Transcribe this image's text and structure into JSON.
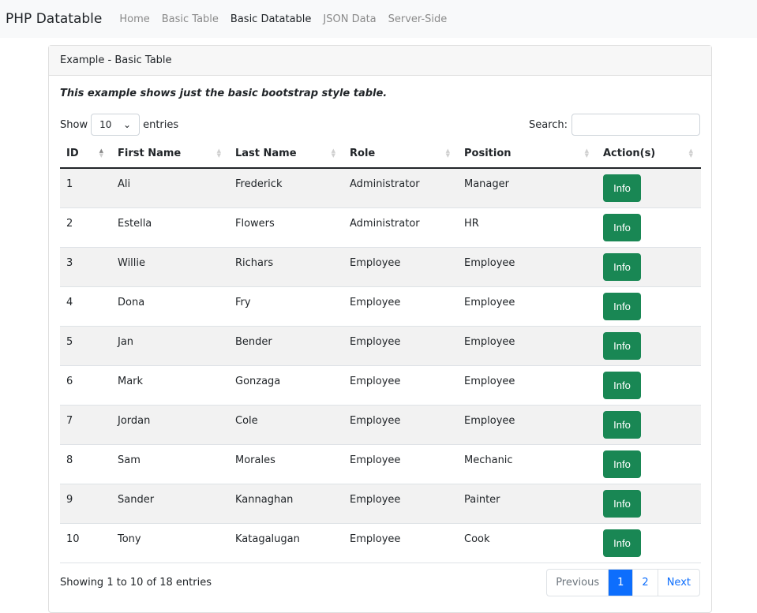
{
  "nav": {
    "brand": "PHP Datatable",
    "links": [
      "Home",
      "Basic Table",
      "Basic Datatable",
      "JSON Data",
      "Server-Side"
    ],
    "active": "Basic Datatable"
  },
  "card": {
    "title": "Example - Basic Table",
    "description": "This example shows just the basic bootstrap style table."
  },
  "controls": {
    "show_label": "Show",
    "length_value": "10",
    "entries_label": "entries",
    "search_label": "Search:",
    "search_value": ""
  },
  "table": {
    "columns": [
      "ID",
      "First Name",
      "Last Name",
      "Role",
      "Position",
      "Action(s)"
    ],
    "rows": [
      [
        "1",
        "Ali",
        "Frederick",
        "Administrator",
        "Manager"
      ],
      [
        "2",
        "Estella",
        "Flowers",
        "Administrator",
        "HR"
      ],
      [
        "3",
        "Willie",
        "Richars",
        "Employee",
        "Employee"
      ],
      [
        "4",
        "Dona",
        "Fry",
        "Employee",
        "Employee"
      ],
      [
        "5",
        "Jan",
        "Bender",
        "Employee",
        "Employee"
      ],
      [
        "6",
        "Mark",
        "Gonzaga",
        "Employee",
        "Employee"
      ],
      [
        "7",
        "Jordan",
        "Cole",
        "Employee",
        "Employee"
      ],
      [
        "8",
        "Sam",
        "Morales",
        "Employee",
        "Mechanic"
      ],
      [
        "9",
        "Sander",
        "Kannaghan",
        "Employee",
        "Painter"
      ],
      [
        "10",
        "Tony",
        "Katagalugan",
        "Employee",
        "Cook"
      ]
    ],
    "action_label": "Info"
  },
  "footer": {
    "info": "Showing 1 to 10 of 18 entries",
    "pagination": [
      "Previous",
      "1",
      "2",
      "Next"
    ],
    "current_page": "1"
  },
  "colors": {
    "button": "#198754",
    "primary": "#0d6efd"
  }
}
